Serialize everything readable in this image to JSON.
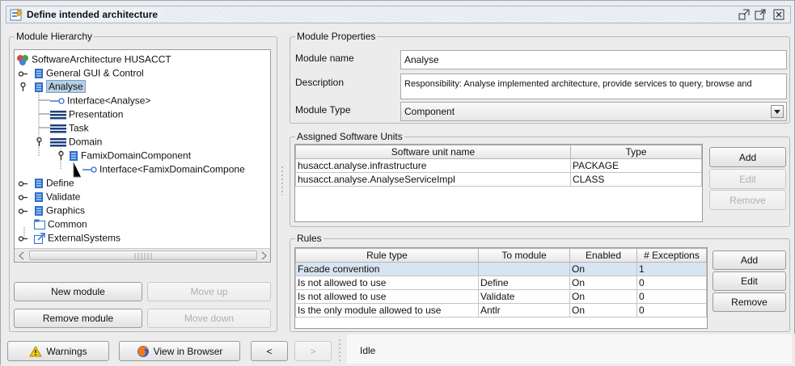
{
  "window": {
    "title": "Define intended architecture"
  },
  "hierarchy": {
    "legend": "Module Hierarchy",
    "tree": [
      {
        "label": "SoftwareArchitecture HUSACCT"
      },
      {
        "label": "General GUI & Control"
      },
      {
        "label": "Analyse"
      },
      {
        "label": "Interface<Analyse>"
      },
      {
        "label": "Presentation"
      },
      {
        "label": "Task"
      },
      {
        "label": "Domain"
      },
      {
        "label": "FamixDomainComponent"
      },
      {
        "label": "Interface<FamixDomainCompone"
      },
      {
        "label": "Define"
      },
      {
        "label": "Validate"
      },
      {
        "label": "Graphics"
      },
      {
        "label": "Common"
      },
      {
        "label": "ExternalSystems"
      }
    ],
    "buttons": {
      "new_module": "New module",
      "move_up": "Move up",
      "remove_module": "Remove module",
      "move_down": "Move down"
    }
  },
  "properties": {
    "legend": "Module Properties",
    "name_label": "Module name",
    "name_value": "Analyse",
    "description_label": "Description",
    "description_value": "Responsibility: Analyse implemented architecture, provide services to query, browse and",
    "type_label": "Module Type",
    "type_value": "Component"
  },
  "units": {
    "legend": "Assigned Software Units",
    "columns": [
      "Software unit name",
      "Type"
    ],
    "rows": [
      [
        "husacct.analyse.infrastructure",
        "PACKAGE"
      ],
      [
        "husacct.analyse.AnalyseServiceImpl",
        "CLASS"
      ]
    ],
    "buttons": {
      "add": "Add",
      "edit": "Edit",
      "remove": "Remove"
    }
  },
  "rules": {
    "legend": "Rules",
    "columns": [
      "Rule type",
      "To module",
      "Enabled",
      "# Exceptions"
    ],
    "rows": [
      [
        "Facade convention",
        "",
        "On",
        "1"
      ],
      [
        "Is not allowed to use",
        "Define",
        "On",
        "0"
      ],
      [
        "Is not allowed to use",
        "Validate",
        "On",
        "0"
      ],
      [
        "Is the only module allowed to use",
        "Antlr",
        "On",
        "0"
      ]
    ],
    "buttons": {
      "add": "Add",
      "edit": "Edit",
      "remove": "Remove"
    }
  },
  "statusbar": {
    "warnings": "Warnings",
    "view_browser": "View in Browser",
    "prev": "<",
    "next": ">",
    "status": "Idle"
  },
  "colors": {
    "selection": "#b8cfe5",
    "module_blue": "#2d6fd0",
    "warning_yellow": "#f2c40f"
  }
}
